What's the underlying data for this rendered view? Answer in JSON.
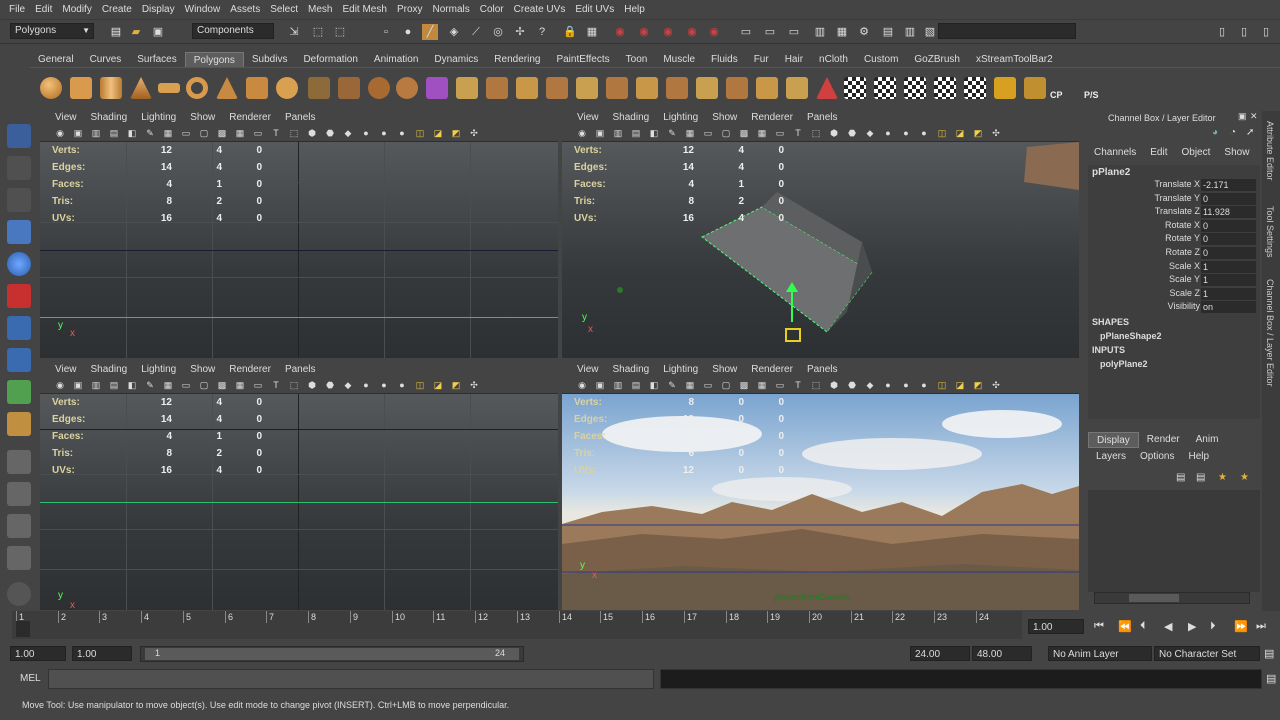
{
  "menubar": {
    "items": [
      "File",
      "Edit",
      "Modify",
      "Create",
      "Display",
      "Window",
      "Assets",
      "Select",
      "Mesh",
      "Edit Mesh",
      "Proxy",
      "Normals",
      "Color",
      "Create UVs",
      "Edit UVs",
      "Help"
    ]
  },
  "statusline": {
    "menuset": "Polygons",
    "component_mode": "Components"
  },
  "shelf": {
    "tabs": [
      "General",
      "Curves",
      "Surfaces",
      "Polygons",
      "Subdivs",
      "Deformation",
      "Animation",
      "Dynamics",
      "Rendering",
      "PaintEffects",
      "Toon",
      "Muscle",
      "Fluids",
      "Fur",
      "Hair",
      "nCloth",
      "Custom",
      "GoZBrush",
      "xStreamToolBar2"
    ],
    "active_tab": "Polygons",
    "cp_label": "CP",
    "ps_label": "P/S"
  },
  "viewport_menu": [
    "View",
    "Shading",
    "Lighting",
    "Show",
    "Renderer",
    "Panels"
  ],
  "hud_labels": {
    "verts": "Verts:",
    "edges": "Edges:",
    "faces": "Faces:",
    "tris": "Tris:",
    "uvs": "UVs:"
  },
  "viewports": {
    "top_left": {
      "hud": [
        [
          "12",
          "4",
          "0"
        ],
        [
          "14",
          "4",
          "0"
        ],
        [
          "4",
          "1",
          "0"
        ],
        [
          "8",
          "2",
          "0"
        ],
        [
          "16",
          "4",
          "0"
        ]
      ],
      "axis_y": "y",
      "axis_x": "x"
    },
    "top_right": {
      "hud": [
        [
          "12",
          "4",
          "0"
        ],
        [
          "14",
          "4",
          "0"
        ],
        [
          "4",
          "1",
          "0"
        ],
        [
          "8",
          "2",
          "0"
        ],
        [
          "16",
          "4",
          "0"
        ]
      ],
      "axis_y": "y",
      "axis_x": "x"
    },
    "bottom_left": {
      "hud": [
        [
          "12",
          "4",
          "0"
        ],
        [
          "14",
          "4",
          "0"
        ],
        [
          "4",
          "1",
          "0"
        ],
        [
          "8",
          "2",
          "0"
        ],
        [
          "16",
          "4",
          "0"
        ]
      ],
      "axis_y": "y",
      "axis_x": "x"
    },
    "bottom_right": {
      "hud": [
        [
          "8",
          "0",
          "0"
        ],
        [
          "10",
          "0",
          "0"
        ],
        [
          "3",
          "0",
          "0"
        ],
        [
          "6",
          "0",
          "0"
        ],
        [
          "12",
          "0",
          "0"
        ]
      ],
      "axis_y": "y",
      "axis_x": "x",
      "camera_label": "projectionCamera"
    }
  },
  "channelbox": {
    "title": "Channel Box / Layer Editor",
    "menu": [
      "Channels",
      "Edit",
      "Object",
      "Show"
    ],
    "object": "pPlane2",
    "attrs": [
      {
        "k": "Translate X",
        "v": "-2.171"
      },
      {
        "k": "Translate Y",
        "v": "0"
      },
      {
        "k": "Translate Z",
        "v": "11.928"
      },
      {
        "k": "Rotate X",
        "v": "0"
      },
      {
        "k": "Rotate Y",
        "v": "0"
      },
      {
        "k": "Rotate Z",
        "v": "0"
      },
      {
        "k": "Scale X",
        "v": "1"
      },
      {
        "k": "Scale Y",
        "v": "1"
      },
      {
        "k": "Scale Z",
        "v": "1"
      },
      {
        "k": "Visibility",
        "v": "on"
      }
    ],
    "shapes_header": "SHAPES",
    "shape": "pPlaneShape2",
    "inputs_header": "INPUTS",
    "input": "polyPlane2"
  },
  "layer_editor": {
    "tabs": [
      "Display",
      "Render",
      "Anim"
    ],
    "menu": [
      "Layers",
      "Options",
      "Help"
    ]
  },
  "right_strip": [
    "Attribute Editor",
    "Tool Settings",
    "Channel Box / Layer Editor"
  ],
  "timeline": {
    "ticks": [
      "1",
      "2",
      "3",
      "4",
      "5",
      "6",
      "7",
      "8",
      "9",
      "10",
      "11",
      "12",
      "13",
      "14",
      "15",
      "16",
      "17",
      "18",
      "19",
      "20",
      "21",
      "22",
      "23",
      "24"
    ],
    "current_frame": "1.00"
  },
  "range": {
    "start": "1.00",
    "playback_start": "1.00",
    "range_min": "1",
    "range_max": "24",
    "playback_end": "24.00",
    "end": "48.00",
    "anim_layer": "No Anim Layer",
    "char_set": "No Character Set"
  },
  "cmdline": {
    "label": "MEL"
  },
  "helpline": {
    "text": "Move Tool: Use manipulator to move object(s). Use edit mode to change pivot (INSERT).  Ctrl+LMB to move perpendicular."
  }
}
